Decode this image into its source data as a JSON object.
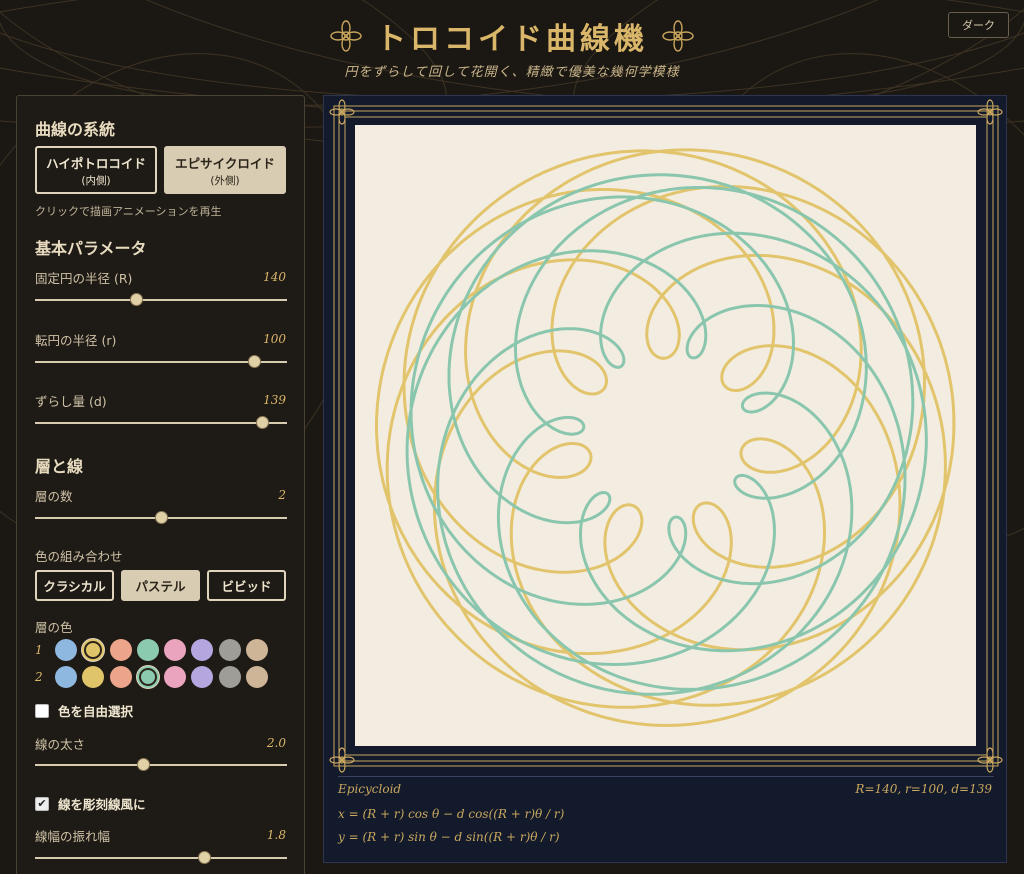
{
  "header": {
    "title": "トロコイド曲線機",
    "subtitle": "円をずらして回して花開く、精緻で優美な幾何学模様",
    "theme_button": "ダーク"
  },
  "panel": {
    "family": {
      "heading": "曲線の系統",
      "hypo_label": "ハイポトロコイド",
      "hypo_sub": "(内側)",
      "epi_label": "エピサイクロイド",
      "epi_sub": "(外側)",
      "hint": "クリックで描画アニメーションを再生",
      "selected": "epi"
    },
    "basic": {
      "heading": "基本パラメータ",
      "R_label": "固定円の半径 (R)",
      "R_value": "140",
      "R_fraction": 0.4,
      "r_label": "転円の半径 (r)",
      "r_value": "100",
      "r_fraction": 0.87,
      "d_label": "ずらし量 (d)",
      "d_value": "139",
      "d_fraction": 0.9
    },
    "layers": {
      "heading": "層と線",
      "count_label": "層の数",
      "count_value": "2",
      "count_fraction": 0.5,
      "palette_label": "色の組み合わせ",
      "palette_buttons": [
        "クラシカル",
        "パステル",
        "ビビッド"
      ],
      "palette_selected": 1,
      "layer_color_label": "層の色",
      "swatch_colors": [
        "#8fb8e0",
        "#e0c46a",
        "#eca58a",
        "#8ccab0",
        "#eba4bd",
        "#b6a6e0",
        "#9e9d98",
        "#cfb597"
      ],
      "rows": [
        {
          "num": "1",
          "selected": 1
        },
        {
          "num": "2",
          "selected": 3
        }
      ],
      "free_color_label": "色を自由選択",
      "width_label": "線の太さ",
      "width_value": "2.0",
      "width_fraction": 0.43,
      "engrave_label": "線を彫刻線風に",
      "amp_label": "線幅の振れ幅",
      "amp_value": "1.8",
      "amp_fraction": 0.67
    }
  },
  "canvas": {
    "curve_name": "Epicycloid",
    "params": "R=140, r=100, d=139",
    "formula_x": "x = (R + r) cos θ − d cos((R + r)θ / r)",
    "formula_y": "y = (R + r) sin θ − d sin((R + r)θ / r)",
    "background": "#f3ede1",
    "frame_color": "#c9a75e",
    "layer_colors": [
      "#e2c46c",
      "#8ac6ae"
    ]
  }
}
